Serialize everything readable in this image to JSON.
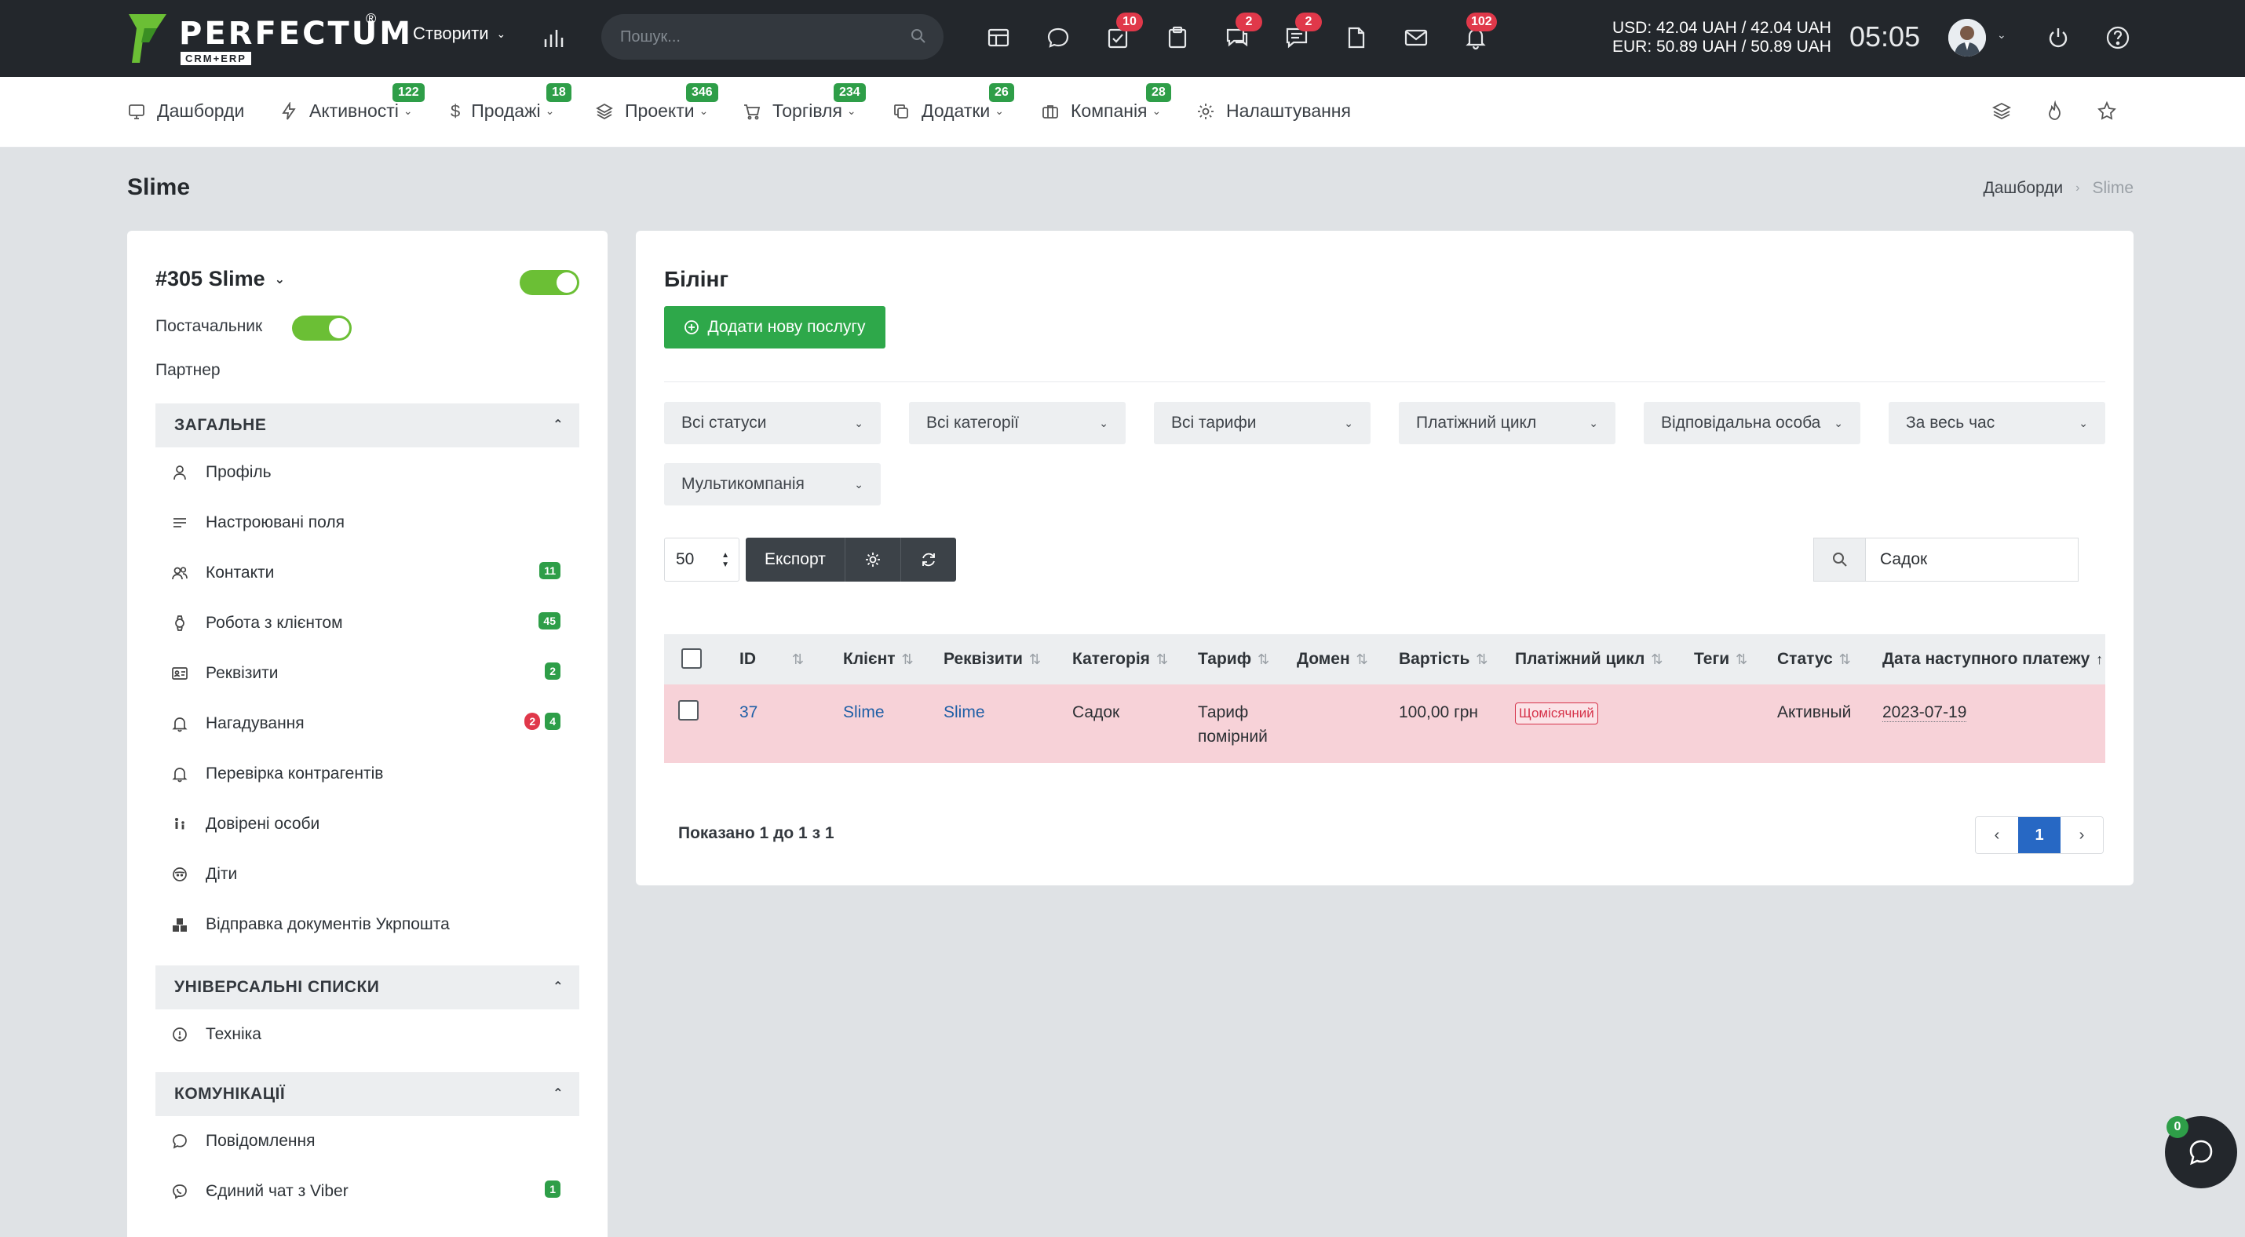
{
  "header": {
    "logo_text": "PERFECTUM",
    "logo_reg": "®",
    "logo_sub": "CRM+ERP",
    "create_label": "Створити",
    "search_placeholder": "Пошук...",
    "badges": {
      "tasks": "10",
      "chat": "2",
      "comments": "2",
      "notifications": "102"
    },
    "currency_usd": "USD: 42.04 UAH / 42.04 UAH",
    "currency_eur": "EUR: 50.89 UAH / 50.89 UAH",
    "time": "05:05"
  },
  "menu": [
    {
      "label": "Дашборди",
      "badge": ""
    },
    {
      "label": "Активності",
      "badge": "122"
    },
    {
      "label": "Продажі",
      "badge": "18"
    },
    {
      "label": "Проекти",
      "badge": "346"
    },
    {
      "label": "Торгівля",
      "badge": "234"
    },
    {
      "label": "Додатки",
      "badge": "26"
    },
    {
      "label": "Компанія",
      "badge": "28"
    },
    {
      "label": "Налаштування",
      "badge": ""
    }
  ],
  "page": {
    "title": "Slime",
    "breadcrumb": [
      "Дашборди",
      "Slime"
    ]
  },
  "left": {
    "client_title": "#305 Slime",
    "supplier_label": "Постачальник",
    "partner_label": "Партнер",
    "sections": {
      "general": "ЗАГАЛЬНЕ",
      "lists": "УНІВЕРСАЛЬНІ СПИСКИ",
      "comms": "КОМУНІКАЦІЇ"
    },
    "general_items": [
      {
        "label": "Профіль",
        "badges": []
      },
      {
        "label": "Настроювані поля",
        "badges": []
      },
      {
        "label": "Контакти",
        "badges": [
          "11"
        ]
      },
      {
        "label": "Робота з клієнтом",
        "badges": [
          "45"
        ]
      },
      {
        "label": "Реквізити",
        "badges": [
          "2"
        ]
      },
      {
        "label": "Нагадування",
        "badges": [
          "2",
          "4"
        ]
      },
      {
        "label": "Перевірка контрагентів",
        "badges": []
      },
      {
        "label": "Довірені особи",
        "badges": []
      },
      {
        "label": "Діти",
        "badges": []
      },
      {
        "label": "Відправка документів Укрпошта",
        "badges": []
      }
    ],
    "list_items": [
      {
        "label": "Техніка"
      }
    ],
    "comm_items": [
      {
        "label": "Повідомлення",
        "badges": []
      },
      {
        "label": "Єдиний чат з Viber",
        "badges": [
          "1"
        ]
      }
    ]
  },
  "billing": {
    "title": "Білінг",
    "add_button": "Додати нову послугу",
    "filters": [
      "Всі статуси",
      "Всі категорії",
      "Всі тарифи",
      "Платіжний цикл",
      "Відповідальна особа",
      "За весь час",
      "Мультикомпанія"
    ],
    "per_page": "50",
    "export_label": "Експорт",
    "search_value": "Садок",
    "columns": [
      "ID",
      "Клієнт",
      "Реквізити",
      "Категорія",
      "Тариф",
      "Домен",
      "Вартість",
      "Платіжний цикл",
      "Теги",
      "Статус",
      "Дата наступного платежу"
    ],
    "rows": [
      {
        "id": "37",
        "client": "Slime",
        "requisites": "Slime",
        "category": "Садок",
        "tariff_line1": "Тариф",
        "tariff_line2": "помірний",
        "domain": "",
        "cost": "100,00 грн",
        "cycle": "Щомісячний",
        "tags": "",
        "status": "Активный",
        "next_payment": "2023-07-19"
      }
    ],
    "shown_text": "Показано 1 до 1 з 1",
    "pager": {
      "prev": "‹",
      "current": "1",
      "next": "›"
    }
  },
  "chat": {
    "badge": "0"
  },
  "colors": {
    "accent_green": "#2ea84a",
    "topbar": "#23272c",
    "badge_red": "#e0384a",
    "row_highlight": "#f7d2d8",
    "pager_active": "#2768c4"
  }
}
